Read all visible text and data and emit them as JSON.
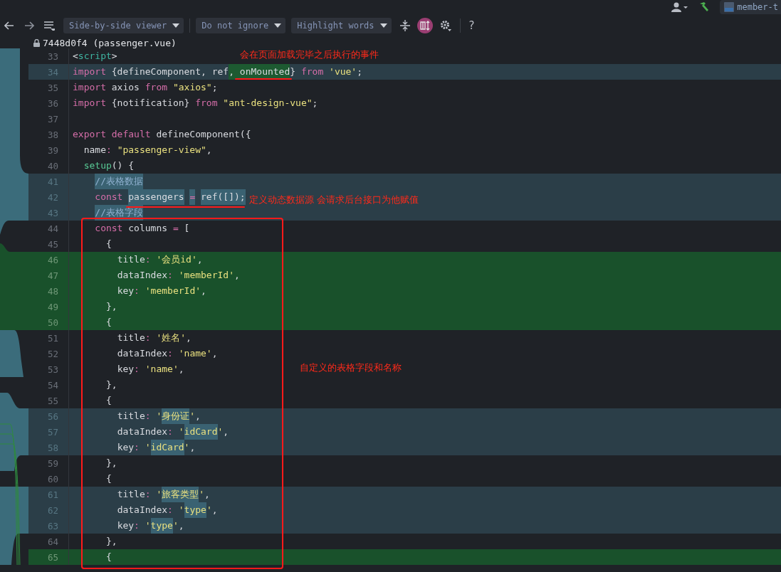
{
  "top_bar": {
    "tab": "member-t"
  },
  "toolbar": {
    "dropdowns": [
      {
        "label": "Side-by-side viewer"
      },
      {
        "label": "Do not ignore"
      },
      {
        "label": "Highlight words"
      }
    ],
    "sync_scroll": {
      "on": true
    },
    "help": "?"
  },
  "file_title": "7448d0f4 (passenger.vue)",
  "lines": [
    {
      "number": "33",
      "kind": "plain",
      "tokens": [
        {
          "t": "<",
          "kind": "text"
        },
        {
          "t": "script",
          "kind": "tag"
        },
        {
          "t": ">",
          "kind": "text"
        }
      ]
    },
    {
      "number": "34",
      "kind": "changed",
      "tokens": [
        {
          "t": "import ",
          "kind": "keyword"
        },
        {
          "t": "{defineComponent, ref",
          "kind": "text"
        },
        {
          "t": ", onMounted",
          "kind": "text",
          "inline_added": true
        },
        {
          "t": "} ",
          "kind": "text"
        },
        {
          "t": "from ",
          "kind": "keyword"
        },
        {
          "t": "'vue'",
          "kind": "string"
        },
        {
          "t": ";",
          "kind": "text"
        }
      ]
    },
    {
      "number": "35",
      "kind": "plain",
      "tokens": [
        {
          "t": "import ",
          "kind": "keyword"
        },
        {
          "t": "axios ",
          "kind": "text"
        },
        {
          "t": "from ",
          "kind": "keyword"
        },
        {
          "t": "\"axios\"",
          "kind": "string"
        },
        {
          "t": ";",
          "kind": "text"
        }
      ]
    },
    {
      "number": "36",
      "kind": "plain",
      "tokens": [
        {
          "t": "import ",
          "kind": "keyword"
        },
        {
          "t": "{notification} ",
          "kind": "text"
        },
        {
          "t": "from ",
          "kind": "keyword"
        },
        {
          "t": "\"ant-design-vue\"",
          "kind": "string"
        },
        {
          "t": ";",
          "kind": "text"
        }
      ]
    },
    {
      "number": "37",
      "kind": "plain"
    },
    {
      "number": "38",
      "kind": "plain",
      "tokens": [
        {
          "t": "export default ",
          "kind": "keyword"
        },
        {
          "t": "defineComponent({",
          "kind": "text"
        }
      ]
    },
    {
      "number": "39",
      "kind": "plain",
      "tokens": [
        {
          "t": "  name",
          "kind": "text"
        },
        {
          "t": ": ",
          "kind": "operator"
        },
        {
          "t": "\"passenger-view\"",
          "kind": "string"
        },
        {
          "t": ",",
          "kind": "text"
        }
      ]
    },
    {
      "number": "40",
      "kind": "plain",
      "tokens": [
        {
          "t": "  setup",
          "kind": "function"
        },
        {
          "t": "() {",
          "kind": "text"
        }
      ]
    },
    {
      "number": "41",
      "kind": "changed",
      "tokens": [
        {
          "t": "    //表格数据",
          "kind": "comment",
          "inline_changed": true
        }
      ]
    },
    {
      "number": "42",
      "kind": "changed",
      "tokens": [
        {
          "t": "    const ",
          "kind": "keyword"
        },
        {
          "t": "passengers ",
          "kind": "text",
          "inline_changed": true
        },
        {
          "t": "= ",
          "kind": "operator",
          "inline_changed": true
        },
        {
          "t": "ref([]);",
          "kind": "text",
          "inline_changed": true
        }
      ]
    },
    {
      "number": "43",
      "kind": "changed",
      "tokens": [
        {
          "t": "    //表格字段",
          "kind": "comment",
          "inline_changed": true
        }
      ]
    },
    {
      "number": "44",
      "kind": "plain",
      "tokens": [
        {
          "t": "    const ",
          "kind": "keyword"
        },
        {
          "t": "columns ",
          "kind": "text"
        },
        {
          "t": "= ",
          "kind": "operator"
        },
        {
          "t": "[",
          "kind": "text"
        }
      ]
    },
    {
      "number": "45",
      "kind": "plain",
      "tokens": [
        {
          "t": "      {",
          "kind": "text"
        }
      ]
    },
    {
      "number": "46",
      "kind": "added",
      "tokens": [
        {
          "t": "        title",
          "kind": "text"
        },
        {
          "t": ": ",
          "kind": "operator"
        },
        {
          "t": "'会员id'",
          "kind": "string"
        },
        {
          "t": ",",
          "kind": "text"
        }
      ]
    },
    {
      "number": "47",
      "kind": "added",
      "tokens": [
        {
          "t": "        dataIndex",
          "kind": "text"
        },
        {
          "t": ": ",
          "kind": "operator"
        },
        {
          "t": "'memberId'",
          "kind": "string"
        },
        {
          "t": ",",
          "kind": "text"
        }
      ]
    },
    {
      "number": "48",
      "kind": "added",
      "tokens": [
        {
          "t": "        key",
          "kind": "text"
        },
        {
          "t": ": ",
          "kind": "operator"
        },
        {
          "t": "'memberId'",
          "kind": "string"
        },
        {
          "t": ",",
          "kind": "text"
        }
      ]
    },
    {
      "number": "49",
      "kind": "added",
      "tokens": [
        {
          "t": "      },",
          "kind": "text"
        }
      ]
    },
    {
      "number": "50",
      "kind": "added",
      "tokens": [
        {
          "t": "      {",
          "kind": "text"
        }
      ]
    },
    {
      "number": "51",
      "kind": "plain",
      "tokens": [
        {
          "t": "        title",
          "kind": "text"
        },
        {
          "t": ": ",
          "kind": "operator"
        },
        {
          "t": "'姓名'",
          "kind": "string"
        },
        {
          "t": ",",
          "kind": "text"
        }
      ]
    },
    {
      "number": "52",
      "kind": "plain",
      "tokens": [
        {
          "t": "        dataIndex",
          "kind": "text"
        },
        {
          "t": ": ",
          "kind": "operator"
        },
        {
          "t": "'name'",
          "kind": "string"
        },
        {
          "t": ",",
          "kind": "text"
        }
      ]
    },
    {
      "number": "53",
      "kind": "plain",
      "tokens": [
        {
          "t": "        key",
          "kind": "text"
        },
        {
          "t": ": ",
          "kind": "operator"
        },
        {
          "t": "'name'",
          "kind": "string"
        },
        {
          "t": ",",
          "kind": "text"
        }
      ]
    },
    {
      "number": "54",
      "kind": "plain",
      "tokens": [
        {
          "t": "      },",
          "kind": "text"
        }
      ]
    },
    {
      "number": "55",
      "kind": "plain",
      "tokens": [
        {
          "t": "      {",
          "kind": "text"
        }
      ]
    },
    {
      "number": "56",
      "kind": "changed",
      "tokens": [
        {
          "t": "        title",
          "kind": "text"
        },
        {
          "t": ": ",
          "kind": "operator"
        },
        {
          "t": "'",
          "kind": "string"
        },
        {
          "t": "身份证",
          "kind": "string",
          "inline_changed": true
        },
        {
          "t": "'",
          "kind": "string"
        },
        {
          "t": ",",
          "kind": "text"
        }
      ]
    },
    {
      "number": "57",
      "kind": "changed",
      "tokens": [
        {
          "t": "        dataIndex",
          "kind": "text"
        },
        {
          "t": ": ",
          "kind": "operator"
        },
        {
          "t": "'",
          "kind": "string"
        },
        {
          "t": "idCard",
          "kind": "string",
          "inline_changed": true
        },
        {
          "t": "'",
          "kind": "string"
        },
        {
          "t": ",",
          "kind": "text"
        }
      ]
    },
    {
      "number": "58",
      "kind": "changed",
      "tokens": [
        {
          "t": "        key",
          "kind": "text"
        },
        {
          "t": ": ",
          "kind": "operator"
        },
        {
          "t": "'",
          "kind": "string"
        },
        {
          "t": "idCard",
          "kind": "string",
          "inline_changed": true
        },
        {
          "t": "'",
          "kind": "string"
        },
        {
          "t": ",",
          "kind": "text"
        }
      ]
    },
    {
      "number": "59",
      "kind": "plain",
      "tokens": [
        {
          "t": "      },",
          "kind": "text"
        }
      ]
    },
    {
      "number": "60",
      "kind": "plain",
      "tokens": [
        {
          "t": "      {",
          "kind": "text"
        }
      ]
    },
    {
      "number": "61",
      "kind": "changed",
      "tokens": [
        {
          "t": "        title",
          "kind": "text"
        },
        {
          "t": ": ",
          "kind": "operator"
        },
        {
          "t": "'",
          "kind": "string"
        },
        {
          "t": "旅客类型",
          "kind": "string",
          "inline_changed": true
        },
        {
          "t": "'",
          "kind": "string"
        },
        {
          "t": ",",
          "kind": "text"
        }
      ]
    },
    {
      "number": "62",
      "kind": "changed",
      "tokens": [
        {
          "t": "        dataIndex",
          "kind": "text"
        },
        {
          "t": ": ",
          "kind": "operator"
        },
        {
          "t": "'",
          "kind": "string"
        },
        {
          "t": "type",
          "kind": "string",
          "inline_changed": true
        },
        {
          "t": "'",
          "kind": "string"
        },
        {
          "t": ",",
          "kind": "text"
        }
      ]
    },
    {
      "number": "63",
      "kind": "changed",
      "tokens": [
        {
          "t": "        key",
          "kind": "text"
        },
        {
          "t": ": ",
          "kind": "operator"
        },
        {
          "t": "'",
          "kind": "string"
        },
        {
          "t": "type",
          "kind": "string",
          "inline_changed": true
        },
        {
          "t": "'",
          "kind": "string"
        },
        {
          "t": ",",
          "kind": "text"
        }
      ]
    },
    {
      "number": "64",
      "kind": "plain",
      "tokens": [
        {
          "t": "      },",
          "kind": "text"
        }
      ]
    },
    {
      "number": "65",
      "kind": "added",
      "tokens": [
        {
          "t": "      {",
          "kind": "text"
        }
      ]
    }
  ],
  "annotations": [
    {
      "text": "会在页面加载完毕之后执行的事件"
    },
    {
      "text": "定义动态数据源 会请求后台接口为他赋值"
    },
    {
      "text": "自定义的表格字段和名称"
    }
  ]
}
